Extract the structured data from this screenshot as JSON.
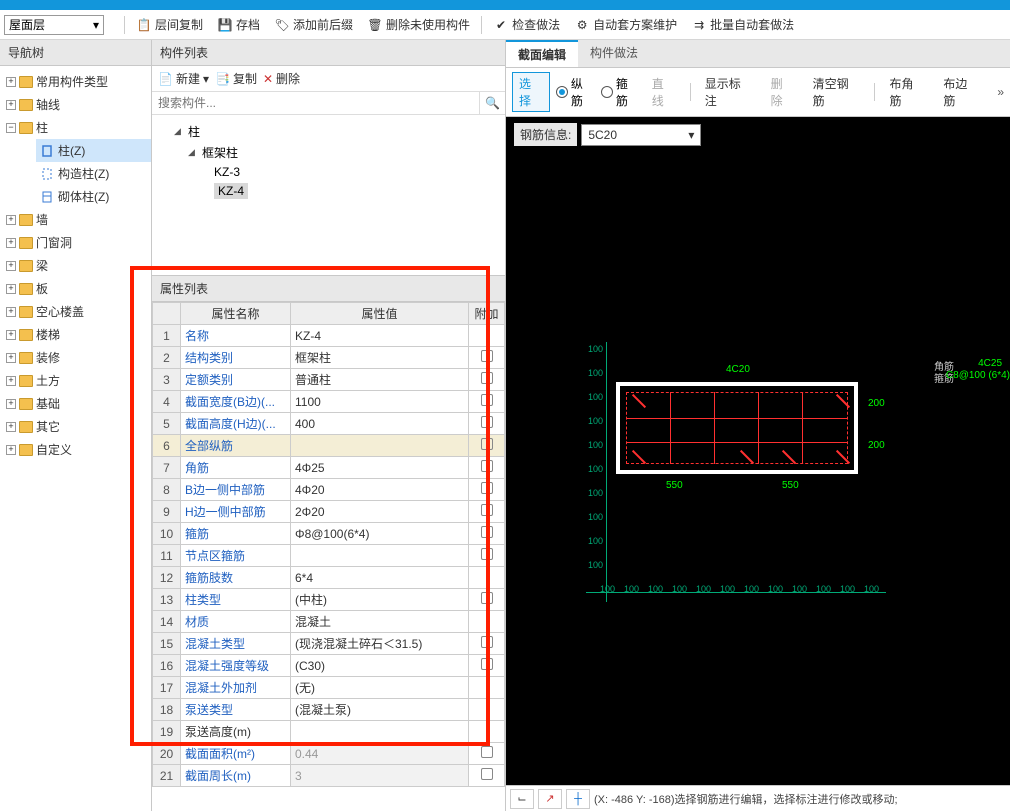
{
  "layer": "屋面层",
  "toolbar": [
    {
      "label": "层间复制"
    },
    {
      "label": "存档"
    },
    {
      "label": "添加前后缀"
    },
    {
      "label": "删除未使用构件"
    },
    {
      "label": "检查做法"
    },
    {
      "label": "自动套方案维护"
    },
    {
      "label": "批量自动套做法"
    }
  ],
  "nav": {
    "title": "导航树",
    "items": [
      "常用构件类型",
      "轴线",
      "柱",
      "墙",
      "门窗洞",
      "梁",
      "板",
      "空心楼盖",
      "楼梯",
      "装修",
      "土方",
      "基础",
      "其它",
      "自定义"
    ],
    "pillar_children": [
      {
        "label": "柱(Z)",
        "sel": true
      },
      {
        "label": "构造柱(Z)"
      },
      {
        "label": "砌体柱(Z)"
      }
    ]
  },
  "complist": {
    "title": "构件列表",
    "btns": {
      "new": "新建",
      "copy": "复制",
      "del": "删除"
    },
    "search_ph": "搜索构件...",
    "tree": {
      "root": "柱",
      "l1": "框架柱",
      "l2": [
        "KZ-3",
        "KZ-4"
      ],
      "sel": "KZ-4"
    }
  },
  "prop": {
    "title": "属性列表",
    "cols": {
      "name": "属性名称",
      "value": "属性值",
      "extra": "附加"
    },
    "rows": [
      {
        "i": 1,
        "n": "名称",
        "v": "KZ-4",
        "ck": false,
        "blue": true
      },
      {
        "i": 2,
        "n": "结构类别",
        "v": "框架柱",
        "ck": true,
        "blue": true
      },
      {
        "i": 3,
        "n": "定额类别",
        "v": "普通柱",
        "ck": true,
        "blue": true
      },
      {
        "i": 4,
        "n": "截面宽度(B边)(...",
        "v": "1100",
        "ck": true,
        "blue": true
      },
      {
        "i": 5,
        "n": "截面高度(H边)(...",
        "v": "400",
        "ck": true,
        "blue": true
      },
      {
        "i": 6,
        "n": "全部纵筋",
        "v": "",
        "ck": true,
        "blue": true,
        "grp": true
      },
      {
        "i": 7,
        "n": "角筋",
        "v": "4Φ25",
        "ck": true,
        "blue": true
      },
      {
        "i": 8,
        "n": "B边一侧中部筋",
        "v": "4Φ20",
        "ck": true,
        "blue": true
      },
      {
        "i": 9,
        "n": "H边一侧中部筋",
        "v": "2Φ20",
        "ck": true,
        "blue": true
      },
      {
        "i": 10,
        "n": "箍筋",
        "v": "Φ8@100(6*4)",
        "ck": true,
        "blue": true
      },
      {
        "i": 11,
        "n": "节点区箍筋",
        "v": "",
        "ck": true,
        "blue": true
      },
      {
        "i": 12,
        "n": "箍筋肢数",
        "v": "6*4",
        "ck": false,
        "blue": true
      },
      {
        "i": 13,
        "n": "柱类型",
        "v": "(中柱)",
        "ck": true,
        "blue": true
      },
      {
        "i": 14,
        "n": "材质",
        "v": "混凝土",
        "ck": false,
        "blue": true
      },
      {
        "i": 15,
        "n": "混凝土类型",
        "v": "(现浇混凝土碎石＜31.5)",
        "ck": true,
        "blue": true
      },
      {
        "i": 16,
        "n": "混凝土强度等级",
        "v": "(C30)",
        "ck": true,
        "blue": true
      },
      {
        "i": 17,
        "n": "混凝土外加剂",
        "v": "(无)",
        "ck": false,
        "blue": true
      },
      {
        "i": 18,
        "n": "泵送类型",
        "v": "(混凝土泵)",
        "ck": false,
        "blue": true
      },
      {
        "i": 19,
        "n": "泵送高度(m)",
        "v": "",
        "ck": false,
        "blue": false
      },
      {
        "i": 20,
        "n": "截面面积(m²)",
        "v": "0.44",
        "ck": true,
        "blue": true,
        "gray": true
      },
      {
        "i": 21,
        "n": "截面周长(m)",
        "v": "3",
        "ck": true,
        "blue": true,
        "gray": true
      }
    ]
  },
  "right": {
    "tabs": [
      "截面编辑",
      "构件做法"
    ],
    "sectb": {
      "select": "选择",
      "v": "纵筋",
      "h": "箍筋",
      "line": "直线",
      "dim": "显示标注",
      "del": "删除",
      "clear": "清空钢筋",
      "corner": "布角筋",
      "edge": "布边筋"
    },
    "rebar": {
      "label": "钢筋信息:",
      "value": "5C20"
    },
    "legend": {
      "corner": "角筋",
      "label2": "4C25",
      "stirrup": "箍筋",
      "label3": "C8@100 (6*4)"
    },
    "dims": {
      "w": "550",
      "h": "200",
      "top": "4C20"
    },
    "ticks": {
      "v": "100",
      "h": "100"
    }
  },
  "status": "(X: -486 Y: -168)选择钢筋进行编辑，选择标注进行修改或移动;"
}
